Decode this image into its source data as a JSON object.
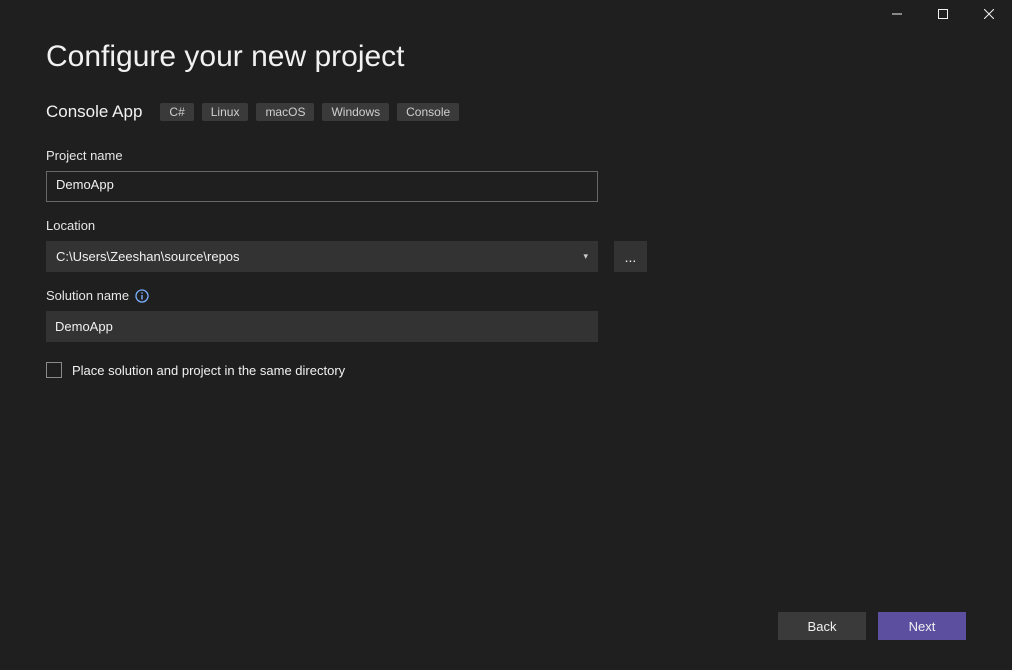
{
  "window": {
    "minimize_label": "Minimize",
    "maximize_label": "Maximize",
    "close_label": "Close"
  },
  "page_title": "Configure your new project",
  "template_name": "Console App",
  "tags": [
    "C#",
    "Linux",
    "macOS",
    "Windows",
    "Console"
  ],
  "fields": {
    "project_name": {
      "label": "Project name",
      "value": "DemoApp"
    },
    "location": {
      "label": "Location",
      "value": "C:\\Users\\Zeeshan\\source\\repos",
      "browse_label": "..."
    },
    "solution_name": {
      "label": "Solution name",
      "value": "DemoApp"
    },
    "same_directory": {
      "label": "Place solution and project in the same directory",
      "checked": false
    }
  },
  "buttons": {
    "back": "Back",
    "next": "Next"
  }
}
